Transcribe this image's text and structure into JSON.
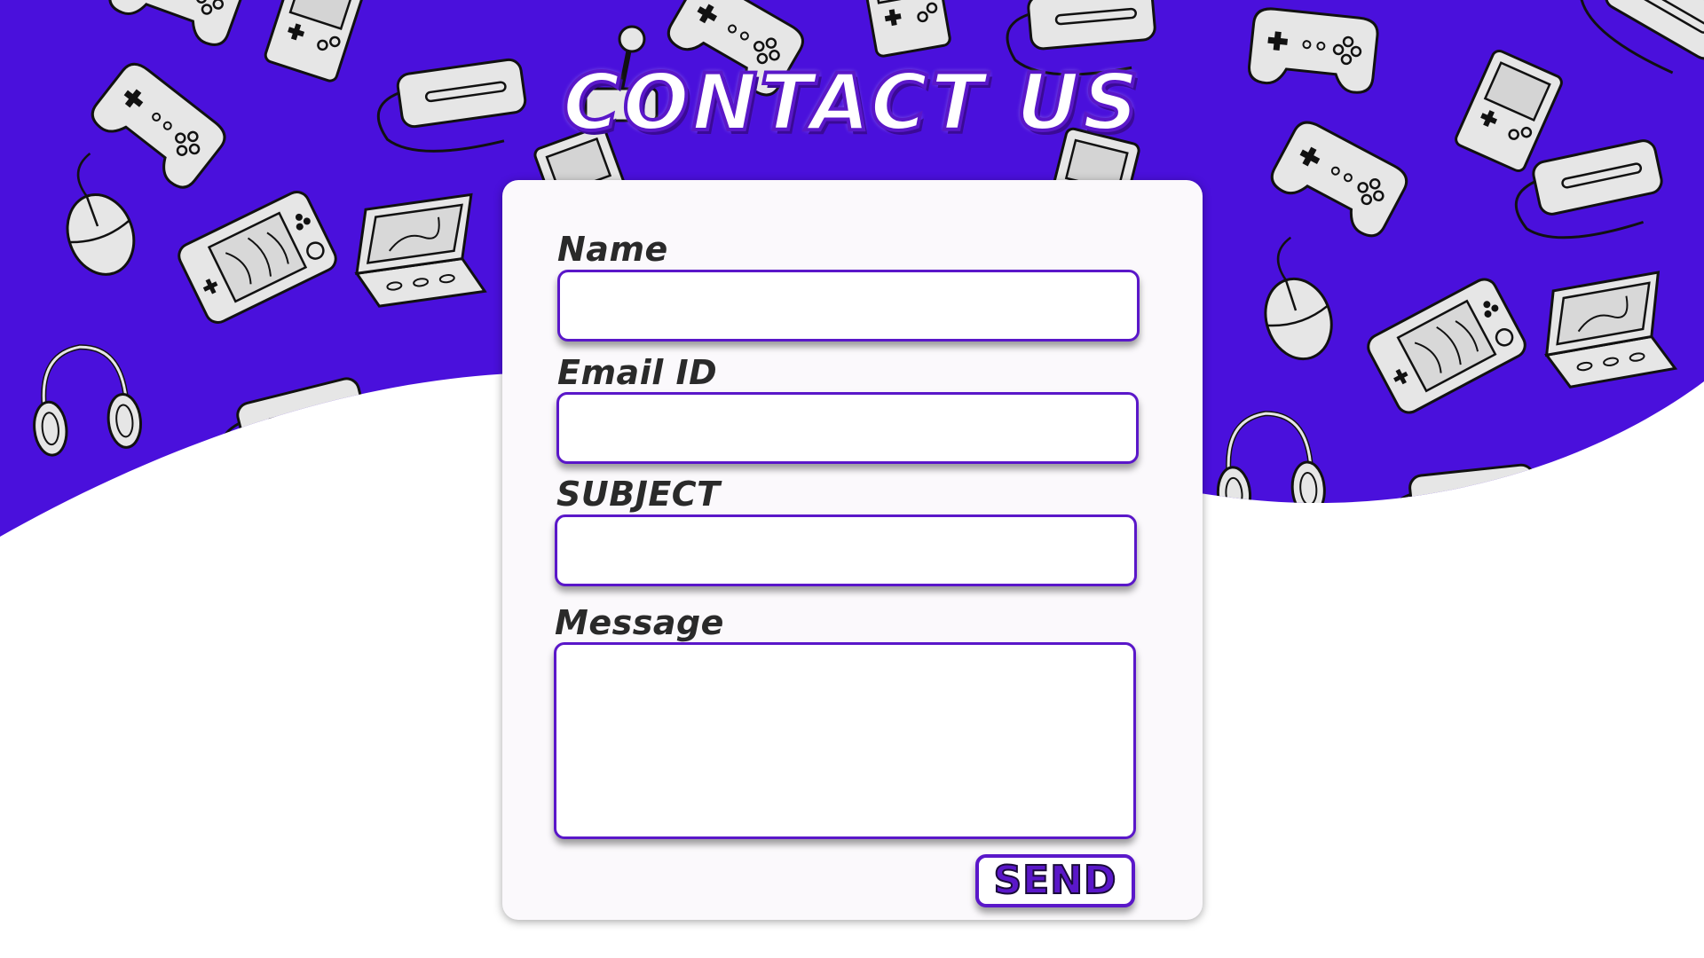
{
  "header": {
    "title": "CONTACT US"
  },
  "colors": {
    "accent": "#5a17c9",
    "hero_background": "#4a10dc",
    "card_background": "#fbf9fc",
    "label_text": "#2a2a2a"
  },
  "form": {
    "fields": [
      {
        "label": "Name",
        "value": "",
        "placeholder": ""
      },
      {
        "label": "Email ID",
        "value": "",
        "placeholder": ""
      },
      {
        "label": "SUBJECT",
        "value": "",
        "placeholder": ""
      },
      {
        "label": "Message",
        "value": "",
        "placeholder": ""
      }
    ],
    "submit_label": "SEND"
  },
  "decor_icons": [
    "gamepad-icon",
    "handheld-console-icon",
    "vr-headset-icon",
    "headphones-icon",
    "mouse-icon",
    "portable-console-icon",
    "laptop-console-icon",
    "joystick-icon"
  ]
}
